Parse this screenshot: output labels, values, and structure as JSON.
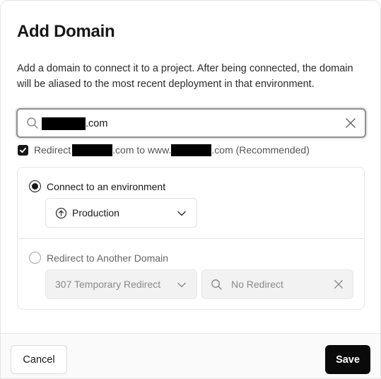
{
  "dialog": {
    "title": "Add Domain",
    "description": "Add a domain to connect it to a project. After being connected, the domain will be aliased to the most recent deployment in that environment."
  },
  "domain_input": {
    "value_suffix": ".com",
    "search_icon": "search-icon",
    "clear_icon": "close-icon"
  },
  "redirect_option": {
    "checked": true,
    "prefix": "Redirect",
    "middle": ".com to www.",
    "suffix": ".com (Recommended)"
  },
  "environment": {
    "option_label": "Connect to an environment",
    "selected": true,
    "select_value": "Production",
    "select_icon": "arrow-up-circle-icon"
  },
  "redirect_domain": {
    "option_label": "Redirect to Another Domain",
    "selected": false,
    "status_select_value": "307 Temporary Redirect",
    "domain_placeholder": "No Redirect"
  },
  "footer": {
    "cancel_label": "Cancel",
    "save_label": "Save"
  },
  "colors": {
    "primary": "#0a0a0a",
    "border": "#e5e5e5",
    "muted_text": "#8a8a8a"
  }
}
